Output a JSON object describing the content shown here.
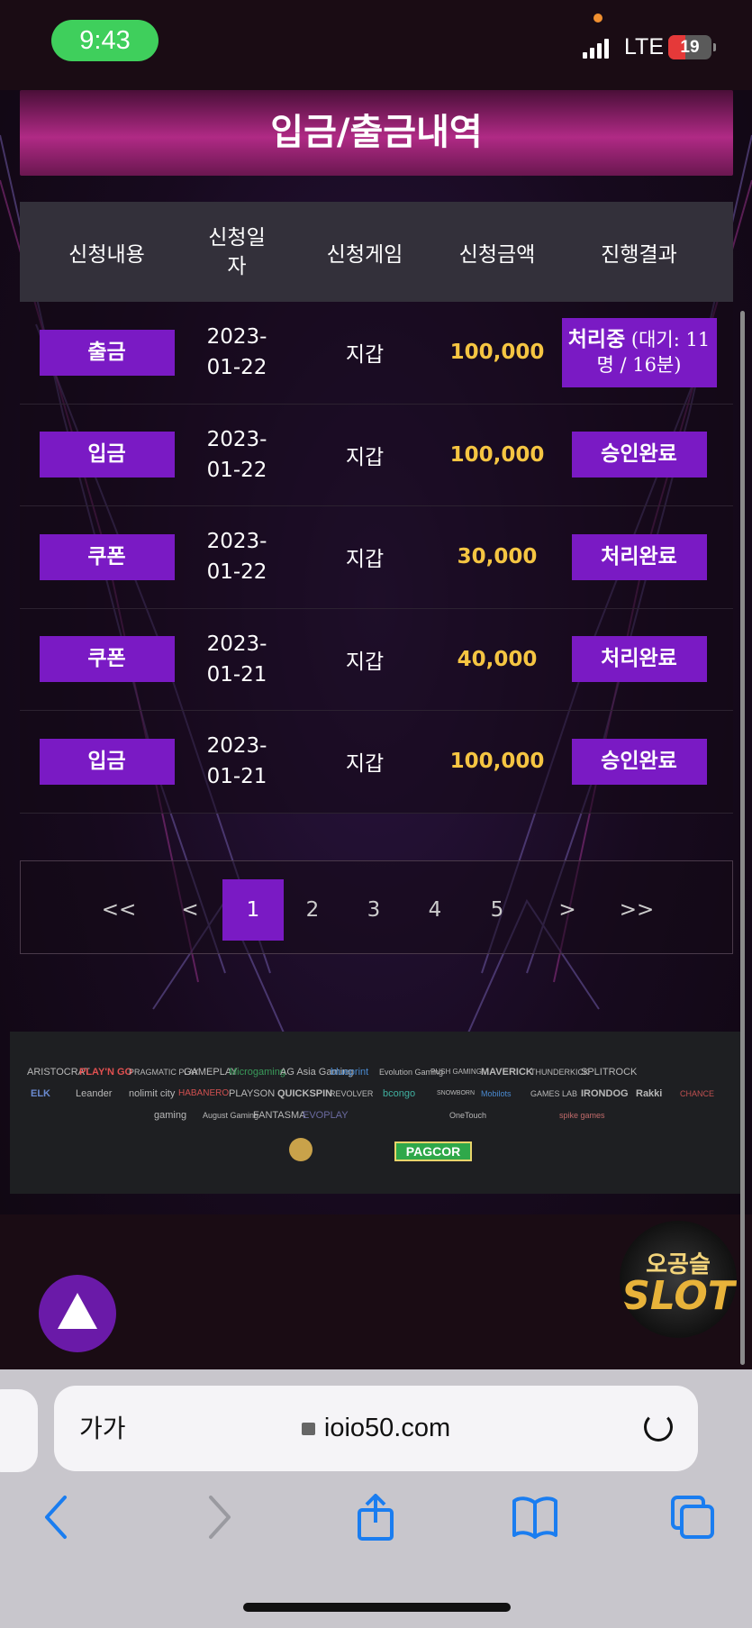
{
  "status_bar": {
    "time": "9:43",
    "network": "LTE",
    "battery": "19"
  },
  "page": {
    "title": "입금/출금내역"
  },
  "table": {
    "headers": [
      "신청내용",
      "신청일자",
      "신청게임",
      "신청금액",
      "진행결과"
    ],
    "rows": [
      {
        "type": "출금",
        "date_line1": "2023-",
        "date_line2": "01-22",
        "game": "지갑",
        "amount": "100,000",
        "status_main": "처리중",
        "status_extra": "(대기: 11명 / 16분)"
      },
      {
        "type": "입금",
        "date_line1": "2023-",
        "date_line2": "01-22",
        "game": "지갑",
        "amount": "100,000",
        "status_main": "승인완료"
      },
      {
        "type": "쿠폰",
        "date_line1": "2023-",
        "date_line2": "01-22",
        "game": "지갑",
        "amount": "30,000",
        "status_main": "처리완료"
      },
      {
        "type": "쿠폰",
        "date_line1": "2023-",
        "date_line2": "01-21",
        "game": "지갑",
        "amount": "40,000",
        "status_main": "처리완료"
      },
      {
        "type": "입금",
        "date_line1": "2023-",
        "date_line2": "01-21",
        "game": "지갑",
        "amount": "100,000",
        "status_main": "승인완료"
      }
    ]
  },
  "pagination": {
    "first": "<<",
    "prev": "<",
    "pages": [
      "1",
      "2",
      "3",
      "4",
      "5"
    ],
    "current": "1",
    "next": ">",
    "last": ">>"
  },
  "providers": {
    "row1": [
      "ARISTOCRAT",
      "PLAY'N GO",
      "PRAGMATIC PLAY",
      "GAMEPLAY",
      "Microgaming",
      "AG Asia Gaming",
      "blueprint",
      "Evolution Gaming",
      "PUSH GAMING",
      "MAVERICK",
      "THUNDERKICK",
      "SPLITROCK"
    ],
    "row2": [
      "ELK",
      "Leander",
      "nolimit city",
      "HABANERO",
      "PLAYSON",
      "QUICKSPIN",
      "REVOLVER",
      "bcongo",
      "SNOWBORN",
      "Mobilots",
      "GAMES LAB",
      "IRONDOG",
      "Rakki",
      "CHANCE"
    ],
    "row3": [
      "gaming",
      "August Gaming",
      "FANTASMA",
      "EVOPLAY",
      "OneTouch",
      "spike games"
    ],
    "license": "PAGCOR"
  },
  "brand": {
    "line1": "오공슬",
    "line2": "SLOT"
  },
  "browser": {
    "text_size": "가가",
    "url": "ioio50.com"
  },
  "colors": {
    "accent_purple": "#7a1ac4",
    "amount_gold": "#f5c542",
    "title_pink": "#b02a85"
  }
}
